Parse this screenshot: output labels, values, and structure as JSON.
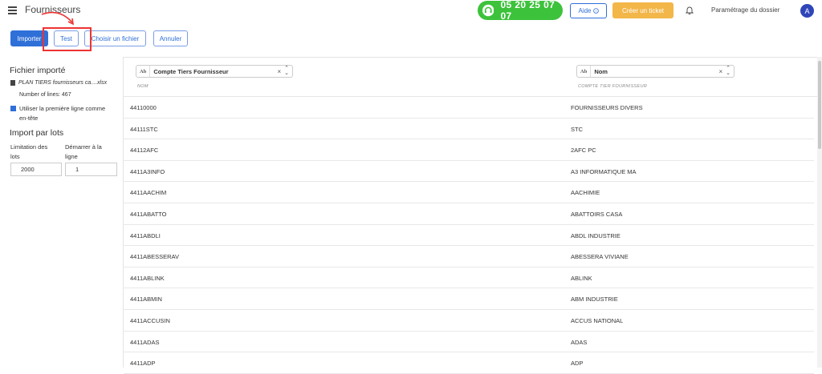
{
  "header": {
    "title": "Fournisseurs",
    "phone": "05 20 25 07 07",
    "aide_label": "Aide",
    "ticket_label": "Créer un ticket",
    "settings_label": "Paramétrage du dossier",
    "avatar_initial": "A"
  },
  "toolbar": {
    "importer_label": "Importer",
    "test_label": "Test",
    "choisir_label": "Choisir un fichier",
    "annuler_label": "Annuler"
  },
  "sidebar": {
    "imported_title": "Fichier importé",
    "file_name": "PLAN TIERS fournisseurs ca....xlsx",
    "lines_text": "Number of lines: 467",
    "header_checkbox_label": "Utiliser la première ligne comme en-tête",
    "batch_title": "Import par lots",
    "limit_label": "Limitation des lots",
    "start_label": "Démarrer à la ligne",
    "limit_value": "2000",
    "start_value": "1"
  },
  "grid": {
    "col1": {
      "select_value": "Compte Tiers Fournisseur",
      "subtitle": "NOM"
    },
    "col2": {
      "select_value": "Nom",
      "subtitle": "COMPTE TIER FOURNISSEUR"
    },
    "rows": [
      [
        "44110000",
        "FOURNISSEURS DIVERS"
      ],
      [
        "44111STC",
        "STC"
      ],
      [
        "44112AFC",
        "2AFC PC"
      ],
      [
        "4411A3INFO",
        "A3 INFORMATIQUE MA"
      ],
      [
        "4411AACHIM",
        "AACHIMIE"
      ],
      [
        "4411ABATTO",
        "ABATTOIRS CASA"
      ],
      [
        "4411ABDLI",
        "ABDL INDUSTRIE"
      ],
      [
        "4411ABESSERAV",
        "ABESSERA VIVIANE"
      ],
      [
        "4411ABLINK",
        "ABLINK"
      ],
      [
        "4411ABMIN",
        "ABM INDUSTRIE"
      ],
      [
        "4411ACCUSIN",
        "ACCUS NATIONAL"
      ],
      [
        "4411ADAS",
        "ADAS"
      ],
      [
        "4411ADP",
        "ADP"
      ]
    ]
  },
  "colors": {
    "primary": "#2f6fd8",
    "phone_green": "#3cc23b",
    "ticket_orange": "#f3b649",
    "highlight_red": "#e33333"
  }
}
